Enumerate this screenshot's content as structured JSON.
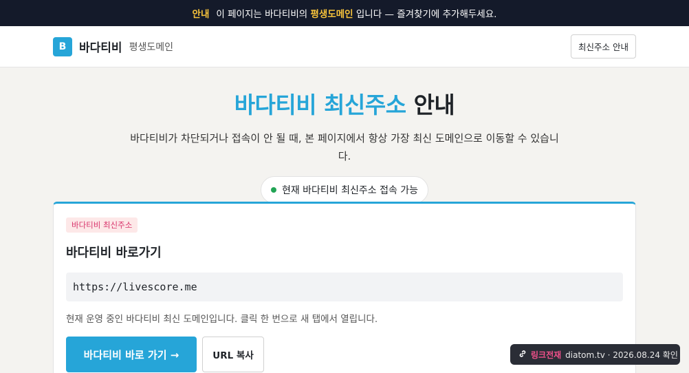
{
  "topbar": {
    "highlight": "안내",
    "text_pre": "이 페이지는 바다티비의",
    "emphasis": "평생도메인",
    "text_post": "입니다 — 즐겨찾기에 추가해두세요."
  },
  "header": {
    "logo_letter": "B",
    "brand": "바다티비",
    "brand_sub": "평생도메인",
    "nav_button": "최신주소 안내"
  },
  "hero": {
    "title_accent": "바다티비 최신주소",
    "title_rest": "안내",
    "description": "바다티비가 차단되거나 접속이 안 될 때, 본 페이지에서 항상 가장 최신 도메인으로 이동할 수 있습니다.",
    "status": "현재 바다티비 최신주소 접속 가능"
  },
  "card": {
    "tag": "바다티비 최신주소",
    "title": "바다티비 바로가기",
    "url": "https://livescore.me",
    "note": "현재 운영 중인 바다티비 최신 도메인입니다. 클릭 한 번으로 새 탭에서 열립니다.",
    "primary_button": "바다티비 바로 가기 →",
    "copy_button": "URL 복사"
  },
  "toast": {
    "icon": "link-icon",
    "label": "링크전재",
    "text": "diatom.tv · 2026.08.24 확인"
  },
  "colors": {
    "accent": "#26a5d8",
    "topbar_bg": "#141a2a",
    "highlight": "#f7c33b",
    "status_dot": "#22a455",
    "tag_text": "#d8326a"
  }
}
